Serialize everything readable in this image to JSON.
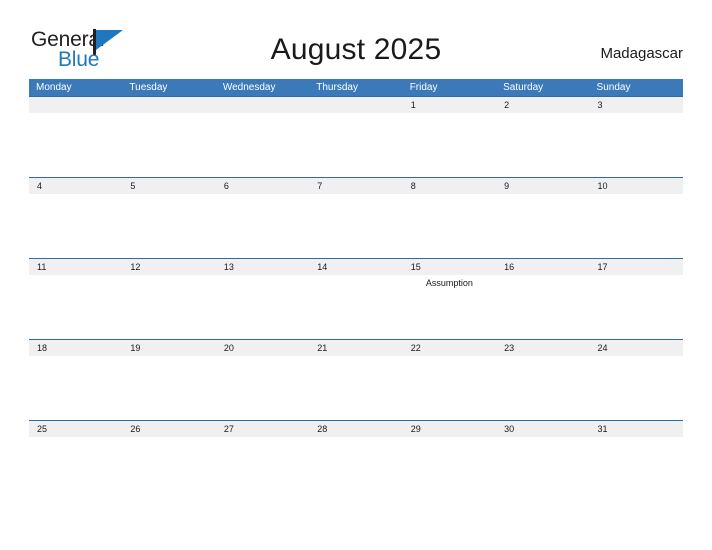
{
  "brand": {
    "name_part1": "General",
    "name_part2": "Blue",
    "flag_icon": "flag-triangle-icon",
    "accent_color": "#1f78bd"
  },
  "header": {
    "title": "August 2025",
    "country": "Madagascar"
  },
  "colors": {
    "header_blue": "#3b79b8",
    "row_border_blue": "#2a6ca8",
    "date_strip_gray": "#f0f0f0",
    "text_dark": "#1a1a1a",
    "white": "#ffffff"
  },
  "calendar": {
    "month": "August",
    "year": "2025",
    "week_start": "Monday",
    "day_headers": [
      "Monday",
      "Tuesday",
      "Wednesday",
      "Thursday",
      "Friday",
      "Saturday",
      "Sunday"
    ],
    "weeks": [
      {
        "dates": [
          "",
          "",
          "",
          "",
          "1",
          "2",
          "3"
        ],
        "events": [
          "",
          "",
          "",
          "",
          "",
          "",
          ""
        ]
      },
      {
        "dates": [
          "4",
          "5",
          "6",
          "7",
          "8",
          "9",
          "10"
        ],
        "events": [
          "",
          "",
          "",
          "",
          "",
          "",
          ""
        ]
      },
      {
        "dates": [
          "11",
          "12",
          "13",
          "14",
          "15",
          "16",
          "17"
        ],
        "events": [
          "",
          "",
          "",
          "",
          "Assumption",
          "",
          ""
        ]
      },
      {
        "dates": [
          "18",
          "19",
          "20",
          "21",
          "22",
          "23",
          "24"
        ],
        "events": [
          "",
          "",
          "",
          "",
          "",
          "",
          ""
        ]
      },
      {
        "dates": [
          "25",
          "26",
          "27",
          "28",
          "29",
          "30",
          "31"
        ],
        "events": [
          "",
          "",
          "",
          "",
          "",
          "",
          ""
        ]
      }
    ],
    "holidays": [
      {
        "date": "15",
        "name": "Assumption",
        "weekday": "Friday"
      }
    ]
  }
}
